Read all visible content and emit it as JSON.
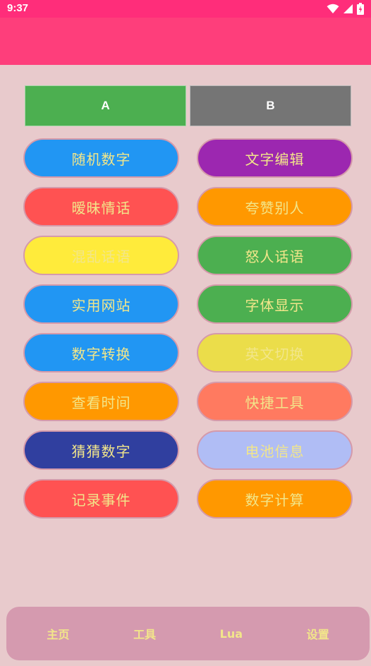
{
  "status_bar": {
    "time": "9:37",
    "icons": [
      "wifi-icon",
      "signal-icon",
      "battery-icon"
    ],
    "bg_color": "#ff2d7a"
  },
  "app_bar": {
    "bg_color": "#fe3e7b"
  },
  "tabs": [
    {
      "label": "A",
      "color": "#4caf50"
    },
    {
      "label": "B",
      "color": "#757575"
    }
  ],
  "buttons": [
    {
      "id": "random-number",
      "label": "随机数字",
      "color": "#2196f3"
    },
    {
      "id": "text-edit",
      "label": "文字编辑",
      "color": "#9c27b0"
    },
    {
      "id": "ambiguous-love",
      "label": "暧昧情话",
      "color": "#ff5252"
    },
    {
      "id": "praise-others",
      "label": "夸赞别人",
      "color": "#ff9800"
    },
    {
      "id": "messy-words",
      "label": "混乱话语",
      "color": "#ffeb3b"
    },
    {
      "id": "angry-words",
      "label": "怒人话语",
      "color": "#4caf50"
    },
    {
      "id": "useful-sites",
      "label": "实用网站",
      "color": "#2196f3"
    },
    {
      "id": "font-display",
      "label": "字体显示",
      "color": "#4caf50"
    },
    {
      "id": "number-convert",
      "label": "数字转换",
      "color": "#2196f3"
    },
    {
      "id": "english-switch",
      "label": "英文切换",
      "color": "#ebdd4a"
    },
    {
      "id": "check-time",
      "label": "查看时间",
      "color": "#ff9800"
    },
    {
      "id": "quick-tools",
      "label": "快捷工具",
      "color": "#ff7a60"
    },
    {
      "id": "guess-number",
      "label": "猜猜数字",
      "color": "#303f9f"
    },
    {
      "id": "battery-info",
      "label": "电池信息",
      "color": "#b0bdf5"
    },
    {
      "id": "record-events",
      "label": "记录事件",
      "color": "#ff5252"
    },
    {
      "id": "number-calc",
      "label": "数字计算",
      "color": "#ff9800"
    }
  ],
  "bottom_nav": [
    {
      "id": "home",
      "label": "主页"
    },
    {
      "id": "tools",
      "label": "工具"
    },
    {
      "id": "lua",
      "label": "Lua"
    },
    {
      "id": "settings",
      "label": "设置"
    }
  ]
}
